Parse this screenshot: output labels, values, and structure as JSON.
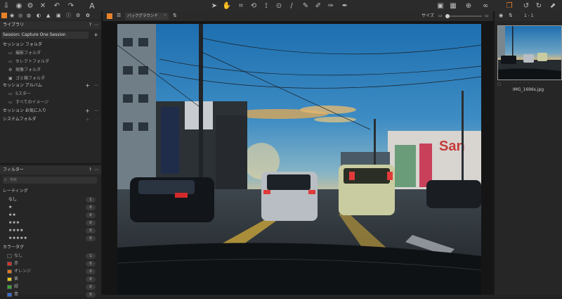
{
  "toolbar": {
    "view_mode_label": "バックグラウンド",
    "size_label": "サイズ",
    "counter": "1 - 1",
    "left_icons": [
      "import-icon",
      "camera-icon",
      "settings-icon",
      "trash-icon",
      "undo-icon",
      "redo-icon",
      "text-icon"
    ],
    "center_icons": [
      "cursor-icon",
      "pan-icon",
      "crop-icon",
      "rotate-icon",
      "keystone-icon",
      "spot-icon",
      "brush-icon",
      "eraser-icon",
      "gradient-icon",
      "picker-icon"
    ],
    "right_icons": [
      "browser-icon",
      "grid-icon",
      "zoom-icon",
      "compare-icon",
      "glasses-icon",
      "copy-icon",
      "undo-icon",
      "redo-icon",
      "export-icon"
    ]
  },
  "library": {
    "title": "ライブラリ",
    "help": "?",
    "session": "Session: Capture One Session",
    "session_folders": "セッション フォルダ",
    "folders": [
      "撮影フォルダ",
      "セレクトフォルダ",
      "現像フォルダ",
      "ゴミ箱フォルダ"
    ],
    "session_albums": "セッション アルバム",
    "albums": [
      "5スター",
      "すべてのイメージ"
    ],
    "favorites": "セッション お気に入り",
    "system": "システムフォルダ"
  },
  "filters": {
    "title": "フィルター",
    "help": "?",
    "search_placeholder": "検索",
    "rating_title": "レーティング",
    "ratings": [
      {
        "label": "なし",
        "count": "1"
      },
      {
        "label": "★",
        "count": "0"
      },
      {
        "label": "★★",
        "count": "0"
      },
      {
        "label": "★★★",
        "count": "0"
      },
      {
        "label": "★★★★",
        "count": "0"
      },
      {
        "label": "★★★★★",
        "count": "0"
      }
    ],
    "color_title": "カラータグ",
    "colors": [
      {
        "label": "なし",
        "count": "1",
        "color": "#2a2a2a"
      },
      {
        "label": "赤",
        "count": "0",
        "color": "#d9312b"
      },
      {
        "label": "オレンジ",
        "count": "0",
        "color": "#e07a1c"
      },
      {
        "label": "黄",
        "count": "0",
        "color": "#e6c818"
      },
      {
        "label": "緑",
        "count": "0",
        "color": "#3aa63a"
      },
      {
        "label": "青",
        "count": "0",
        "color": "#2f6fd6"
      }
    ]
  },
  "browser": {
    "filename": "IMG_1696s.jpg",
    "stars": "· · · · ·"
  },
  "colors": {
    "accent": "#e8822a"
  }
}
